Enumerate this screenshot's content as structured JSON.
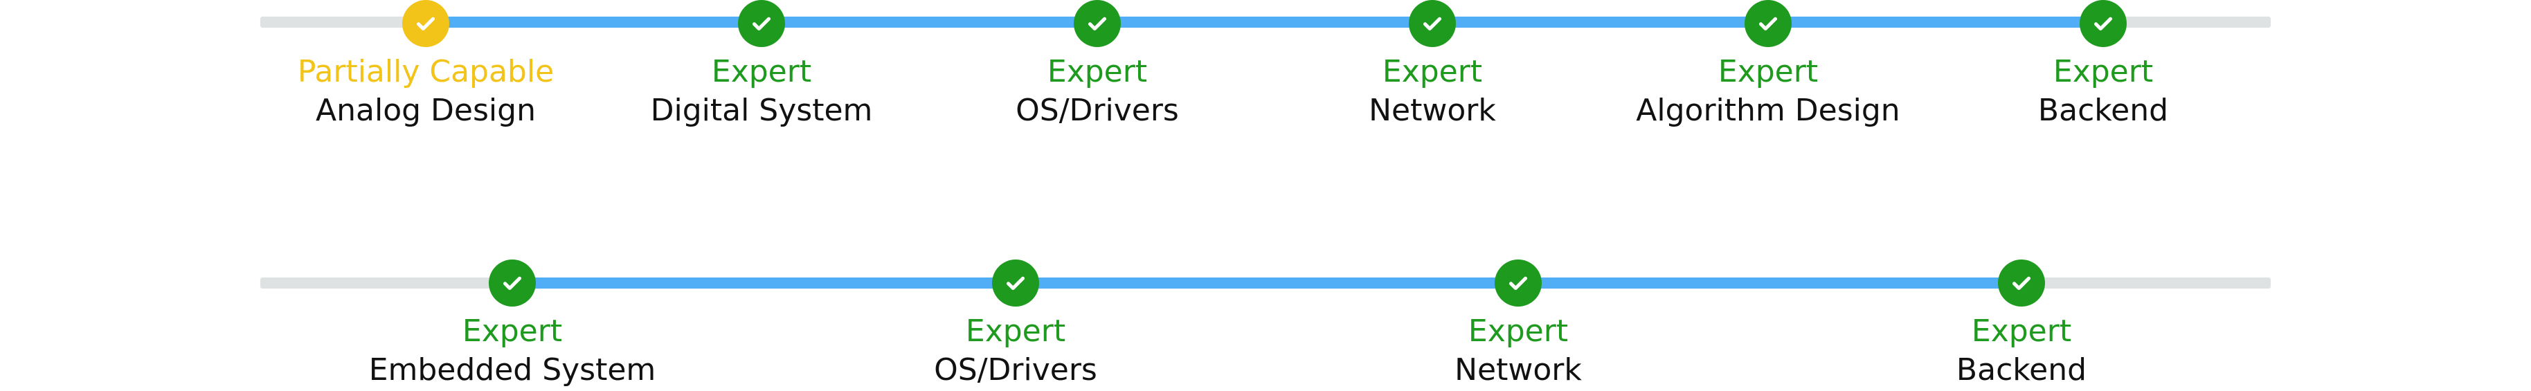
{
  "colors": {
    "track_background": "#dfe2e2",
    "track_progress": "#4faef5",
    "expert": "#1e9a1e",
    "partially_capable": "#f2c318",
    "label_text": "#111111"
  },
  "rows": [
    {
      "items": [
        {
          "level": "Partially Capable",
          "name": "Analog Design",
          "status": "partial",
          "icon": "check-icon"
        },
        {
          "level": "Expert",
          "name": "Digital System",
          "status": "expert",
          "icon": "check-icon"
        },
        {
          "level": "Expert",
          "name": "OS/Drivers",
          "status": "expert",
          "icon": "check-icon"
        },
        {
          "level": "Expert",
          "name": "Network",
          "status": "expert",
          "icon": "check-icon"
        },
        {
          "level": "Expert",
          "name": "Algorithm Design",
          "status": "expert",
          "icon": "check-icon"
        },
        {
          "level": "Expert",
          "name": "Backend",
          "status": "expert",
          "icon": "check-icon"
        }
      ]
    },
    {
      "items": [
        {
          "level": "Expert",
          "name": "Embedded System",
          "status": "expert",
          "icon": "check-icon"
        },
        {
          "level": "Expert",
          "name": "OS/Drivers",
          "status": "expert",
          "icon": "check-icon"
        },
        {
          "level": "Expert",
          "name": "Network",
          "status": "expert",
          "icon": "check-icon"
        },
        {
          "level": "Expert",
          "name": "Backend",
          "status": "expert",
          "icon": "check-icon"
        }
      ]
    }
  ]
}
